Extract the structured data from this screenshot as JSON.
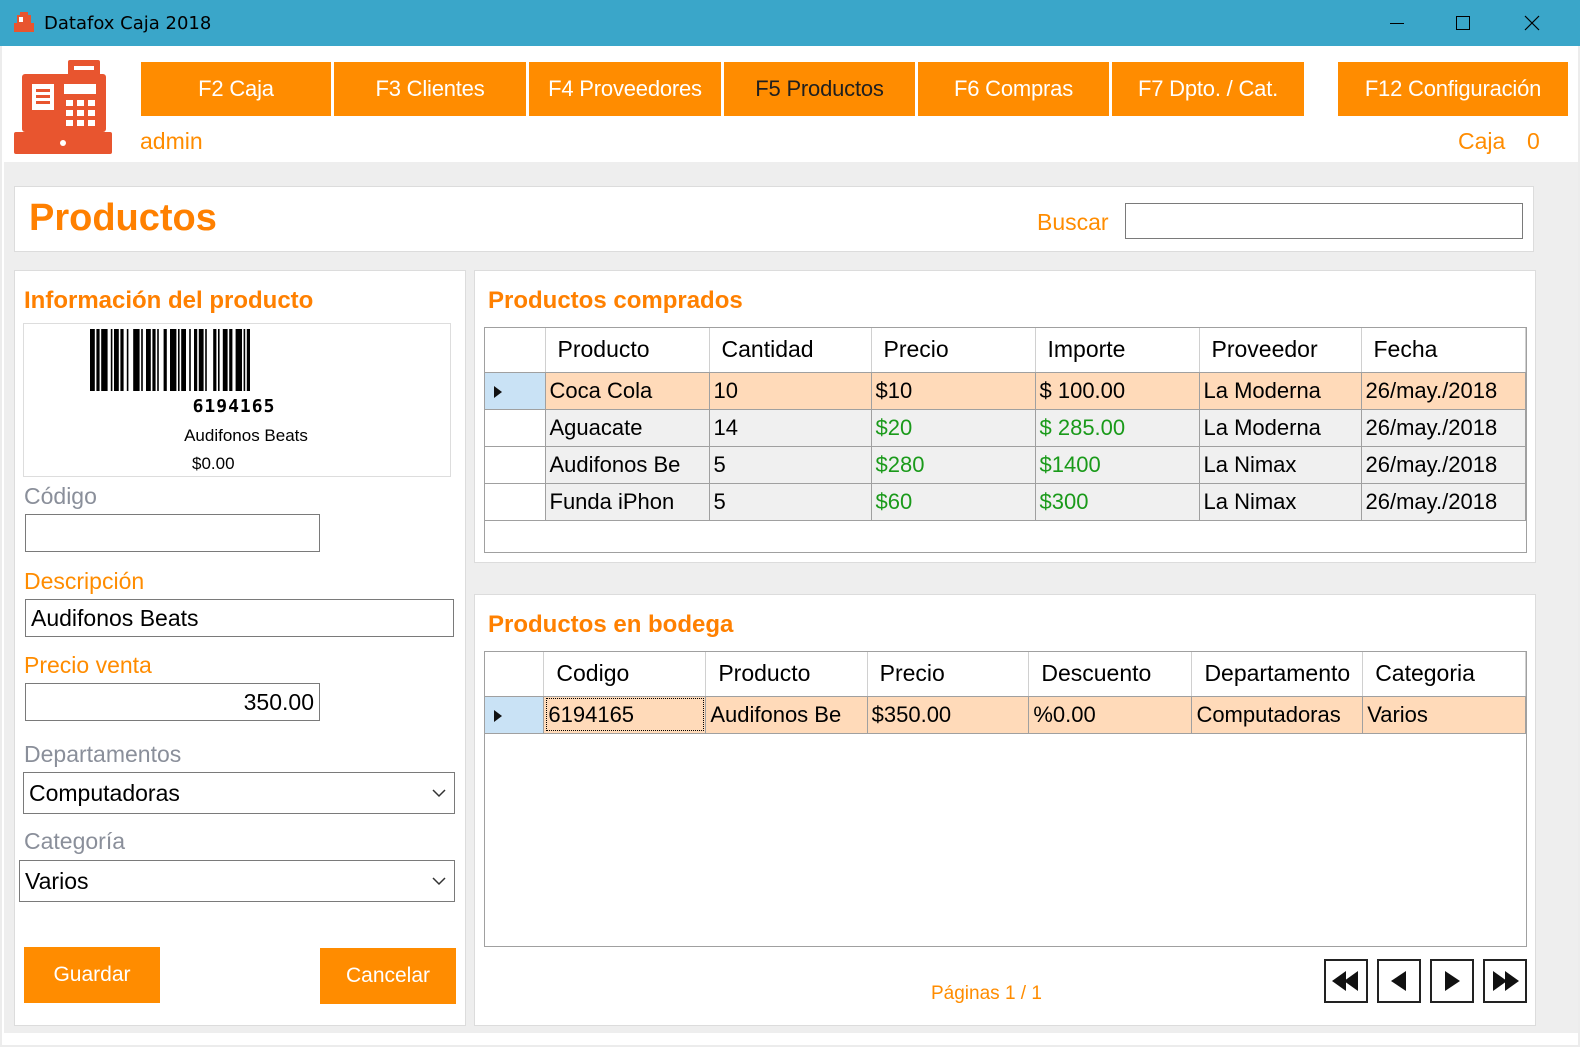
{
  "window": {
    "title": "Datafox Caja 2018"
  },
  "nav": {
    "items": [
      {
        "label": "F2 Caja"
      },
      {
        "label": "F3 Clientes"
      },
      {
        "label": "F4 Proveedores"
      },
      {
        "label": "F5 Productos"
      },
      {
        "label": "F6 Compras"
      },
      {
        "label": "F7 Dpto. / Cat."
      }
    ],
    "config_label": "F12 Configuración",
    "active": "F5 Productos"
  },
  "header": {
    "user": "admin",
    "caja_label": "Caja",
    "caja_number": "0"
  },
  "page": {
    "title": "Productos",
    "search_label": "Buscar",
    "search_value": ""
  },
  "product_info": {
    "title": "Información del producto",
    "barcode_number": "6194165",
    "barcode_name": "Audifonos Beats",
    "barcode_price": "$0.00",
    "codigo_label": "Código",
    "codigo_value": "",
    "descripcion_label": "Descripción",
    "descripcion_value": "Audifonos Beats",
    "precio_label": "Precio venta",
    "precio_value": "350.00",
    "departamentos_label": "Departamentos",
    "departamento_value": "Computadoras",
    "categoria_label": "Categoría",
    "categoria_value": "Varios",
    "save_label": "Guardar",
    "cancel_label": "Cancelar"
  },
  "purchased": {
    "title": "Productos comprados",
    "columns": [
      "Producto",
      "Cantidad",
      "Precio",
      "Importe",
      "Proveedor",
      "Fecha"
    ],
    "rows": [
      [
        "Coca Cola",
        "10",
        "$10",
        "$ 100.00",
        "La Moderna",
        "26/may./2018"
      ],
      [
        "Aguacate",
        "14",
        "$20",
        "$ 285.00",
        "La Moderna",
        "26/may./2018"
      ],
      [
        "Audifonos Be",
        "5",
        "$280",
        "$1400",
        "La Nimax",
        "26/may./2018"
      ],
      [
        "Funda iPhon",
        "5",
        "$60",
        "$300",
        "La Nimax",
        "26/may./2018"
      ]
    ]
  },
  "warehouse": {
    "title": "Productos en bodega",
    "columns": [
      "Codigo",
      "Producto",
      "Precio",
      "Descuento",
      "Departamento",
      "Categoria"
    ],
    "rows": [
      [
        "6194165",
        "Audifonos Be",
        "$350.00",
        "%0.00",
        "Computadoras",
        "Varios"
      ]
    ]
  },
  "pager": {
    "label": "Páginas 1 / 1"
  },
  "colors": {
    "accent": "#ff8c00",
    "titlebar": "#3aa6c9",
    "selected_row": "#ffdab9",
    "money_green": "#1a9a1a"
  }
}
